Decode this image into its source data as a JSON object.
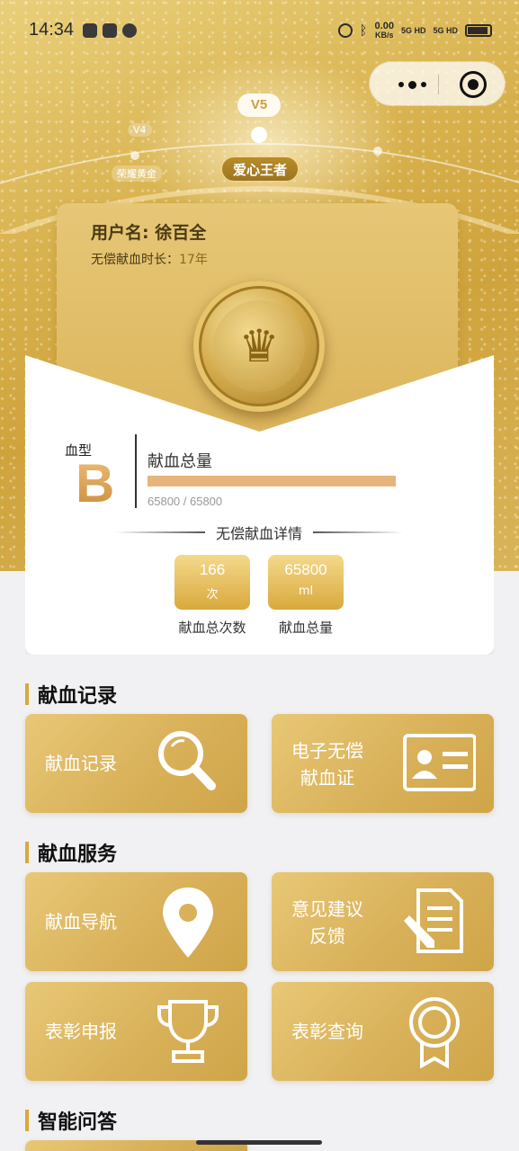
{
  "status_bar": {
    "time": "14:34",
    "net_speed_value": "0.00",
    "net_speed_unit": "KB/s",
    "signal_1": "5G HD",
    "signal_2": "5G HD"
  },
  "level": {
    "prev_level": "V4",
    "prev_title": "荣耀黄金",
    "current_level": "V5",
    "current_title": "爱心王者"
  },
  "profile": {
    "username_text": "用户名: 徐百全",
    "years_label": "无偿献血时长：",
    "years_value": "17年"
  },
  "blood": {
    "type_label": "血型",
    "type_value": "B",
    "total_label": "献血总量",
    "progress_text": "65800 / 65800",
    "progress_fraction": 1.0
  },
  "details": {
    "title": "无偿献血详情",
    "stats": [
      {
        "value": "166",
        "unit": "次",
        "caption": "献血总次数"
      },
      {
        "value": "65800",
        "unit": "ml",
        "caption": "献血总量"
      }
    ]
  },
  "sections": {
    "records_title": "献血记录",
    "services_title": "献血服务",
    "qa_title": "智能问答"
  },
  "tiles": {
    "records": "献血记录",
    "certificate_line1": "电子无偿",
    "certificate_line2": "献血证",
    "navigation": "献血导航",
    "feedback_line1": "意见建议",
    "feedback_line2": "反馈",
    "commend_apply": "表彰申报",
    "commend_query": "表彰查询"
  },
  "colors": {
    "gold": "#d9b15a",
    "gold_dark": "#9e7420",
    "accent_orange": "#e6b57c"
  }
}
